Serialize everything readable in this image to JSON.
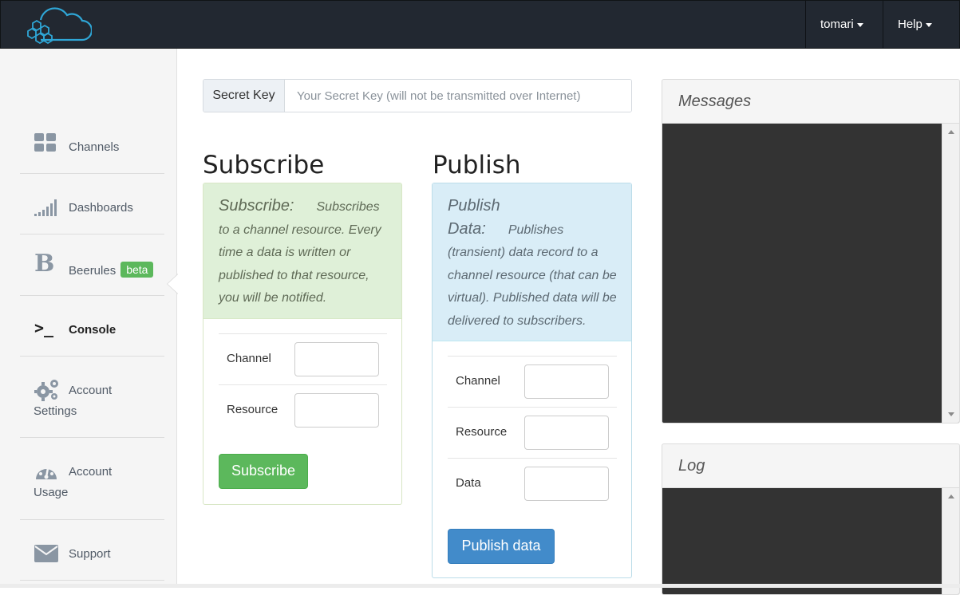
{
  "navbar": {
    "logo": "cloud-hexagon-logo",
    "user_menu": "tomari",
    "help_menu": "Help"
  },
  "sidebar": {
    "items": [
      {
        "label": "Channels",
        "icon": "grid-icon"
      },
      {
        "label": "Dashboards",
        "icon": "signal-bars-icon"
      },
      {
        "label": "Beerules",
        "icon": "bold-b-icon",
        "badge": "beta"
      },
      {
        "label": "Console",
        "icon": "terminal-icon",
        "active": true
      },
      {
        "label": "Account",
        "label_rest": "Settings",
        "icon": "gears-icon"
      },
      {
        "label": "Account",
        "label_rest": "Usage",
        "icon": "dashboard-gauge-icon"
      },
      {
        "label": "Support",
        "icon": "envelope-icon"
      }
    ]
  },
  "secret_key": {
    "addon": "Secret Key",
    "placeholder": "Your Secret Key (will not be transmitted over Internet)",
    "value": ""
  },
  "subscribe": {
    "title": "Subscribe",
    "head_title": "Subscribe:",
    "description": "Subscribes to a channel resource. Every time a data is written or published to that resource, you will be notified.",
    "fields": [
      {
        "label": "Channel",
        "value": ""
      },
      {
        "label": "Resource",
        "value": ""
      }
    ],
    "button": "Subscribe"
  },
  "publish": {
    "title": "Publish",
    "head_title_1": "Publish",
    "head_title_2": "Data:",
    "description": "Publishes (transient) data record to a channel resource (that can be virtual). Published data will be delivered to subscribers.",
    "fields": [
      {
        "label": "Channel",
        "value": ""
      },
      {
        "label": "Resource",
        "value": ""
      },
      {
        "label": "Data",
        "value": ""
      }
    ],
    "button": "Publish data"
  },
  "messages": {
    "title": "Messages"
  },
  "log": {
    "title": "Log"
  },
  "colors": {
    "navbar": "#222831",
    "subscribe_head": "#dff0d8",
    "publish_head": "#d9edf7",
    "btn_success": "#5cb85c",
    "btn_primary": "#428bca",
    "console_bg": "#333333"
  }
}
